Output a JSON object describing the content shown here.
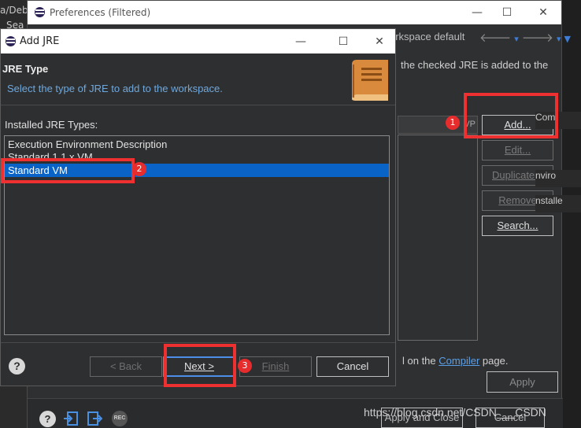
{
  "background": {
    "crumb_top": "a/Deb",
    "crumb_second": "Sea"
  },
  "preferences": {
    "title": "Preferences (Filtered)",
    "workspace_default": "orkspace default",
    "description": "the checked JRE is added to the",
    "table_header": "VP",
    "buttons": {
      "add": "Add...",
      "edit": "Edit...",
      "duplicate": "Duplicate...",
      "remove": "Remove",
      "search": "Search..."
    },
    "right_edge": {
      "com": "Com",
      "enviro": "nviro",
      "installe": "nstalle"
    },
    "compiler_prefix": "l on the",
    "compiler_link": "Compiler",
    "compiler_suffix": "page.",
    "apply": "Apply",
    "apply_and_close": "Apply and Close",
    "cancel": "Cancel",
    "watermark": "https://blog.csdn.net/CSDN___CSDN"
  },
  "dialog": {
    "title": "Add JRE",
    "header_title": "JRE Type",
    "header_desc": "Select the type of JRE to add to the workspace.",
    "types_label": "Installed JRE Types:",
    "types": [
      "Execution Environment Description",
      "Standard 1.1.x VM",
      "Standard VM"
    ],
    "selected_index": 2,
    "buttons": {
      "back": "< Back",
      "next": "Next >",
      "finish": "Finish",
      "cancel": "Cancel"
    }
  },
  "annotations": [
    "1",
    "2",
    "3"
  ],
  "colors": {
    "selection": "#0a64c8",
    "annotation_red": "#ee3030",
    "link": "#5aa0e8",
    "book": "#d98a3c"
  }
}
